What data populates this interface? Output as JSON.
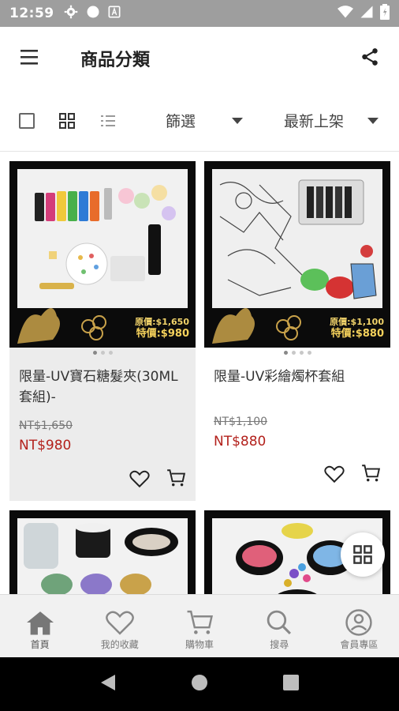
{
  "status_bar": {
    "time": "12:59"
  },
  "header": {
    "title": "商品分類"
  },
  "filter_bar": {
    "filter_label": "篩選",
    "sort_label": "最新上架"
  },
  "products": [
    {
      "name": "限量-UV寶石糖髮夾(30ML套組)-",
      "original_price": "NT$1,650",
      "price": "NT$980",
      "tag_original": "原價:$1,650",
      "tag_deal": "特價:$980"
    },
    {
      "name": "限量-UV彩繪燭杯套組",
      "original_price": "NT$1,100",
      "price": "NT$880",
      "tag_original": "原價:$1,100",
      "tag_deal": "特價:$880"
    }
  ],
  "bottom_nav": {
    "items": [
      {
        "label": "首頁",
        "icon": "home-icon"
      },
      {
        "label": "我的收藏",
        "icon": "heart-icon"
      },
      {
        "label": "購物車",
        "icon": "cart-icon"
      },
      {
        "label": "搜尋",
        "icon": "search-icon"
      },
      {
        "label": "會員專區",
        "icon": "user-icon"
      }
    ]
  },
  "colors": {
    "price_red": "#b3211c",
    "status_bar": "#9e9e9e",
    "tag_gold": "#f1d36a"
  }
}
